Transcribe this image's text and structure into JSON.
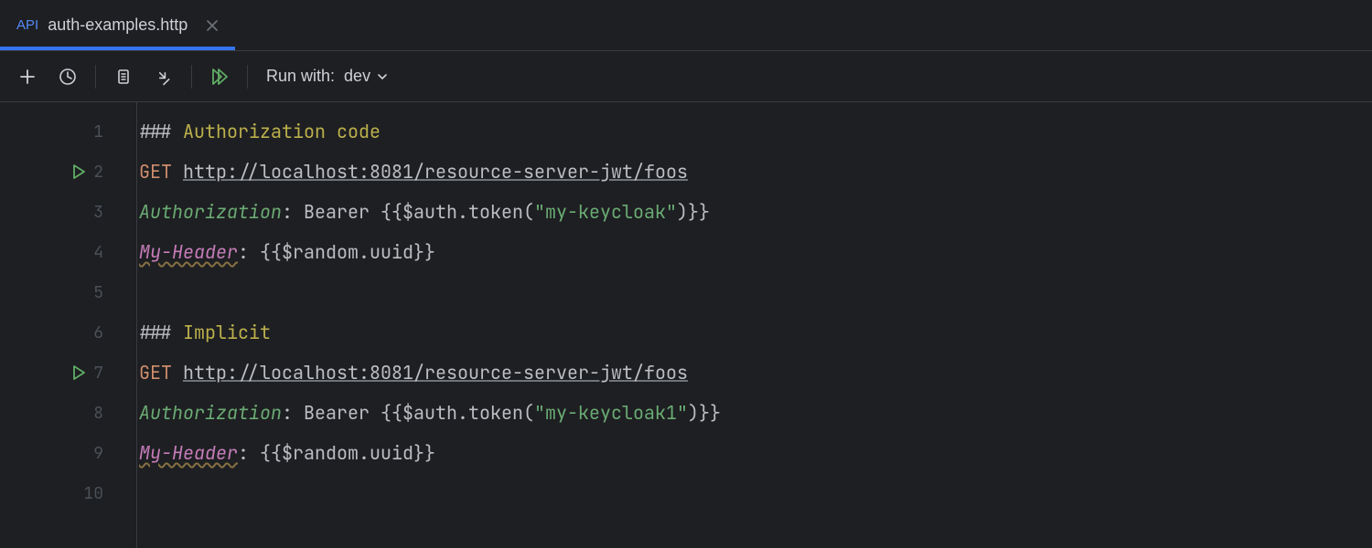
{
  "tab": {
    "badge": "API",
    "title": "auth-examples.http"
  },
  "toolbar": {
    "run_with_label": "Run with:",
    "env": "dev"
  },
  "gutter": {
    "lines": [
      "1",
      "2",
      "3",
      "4",
      "5",
      "6",
      "7",
      "8",
      "9",
      "10"
    ],
    "runMarkers": [
      2,
      7
    ]
  },
  "code": {
    "l1_hash": "### ",
    "l1_title": "Authorization code",
    "l2_method": "GET ",
    "l2_url": "http://localhost:8081/resource-server-jwt/foos",
    "l3_hdr": "Authorization",
    "l3_colon": ": ",
    "l3_bearer": "Bearer ",
    "l3_open": "{{",
    "l3_fn": "$auth.token(",
    "l3_str": "\"my-keycloak\"",
    "l3_close_paren": ")",
    "l3_close": "}}",
    "l4_hdr": "My-Header",
    "l4_colon": ": ",
    "l4_open": "{{",
    "l4_expr": "$random.uuid",
    "l4_close": "}}",
    "l6_hash": "### ",
    "l6_title": "Implicit",
    "l7_method": "GET ",
    "l7_url": "http://localhost:8081/resource-server-jwt/foos",
    "l8_hdr": "Authorization",
    "l8_colon": ": ",
    "l8_bearer": "Bearer ",
    "l8_open": "{{",
    "l8_fn": "$auth.token(",
    "l8_str": "\"my-keycloak1\"",
    "l8_close_paren": ")",
    "l8_close": "}}",
    "l9_hdr": "My-Header",
    "l9_colon": ": ",
    "l9_open": "{{",
    "l9_expr": "$random.uuid",
    "l9_close": "}}"
  }
}
